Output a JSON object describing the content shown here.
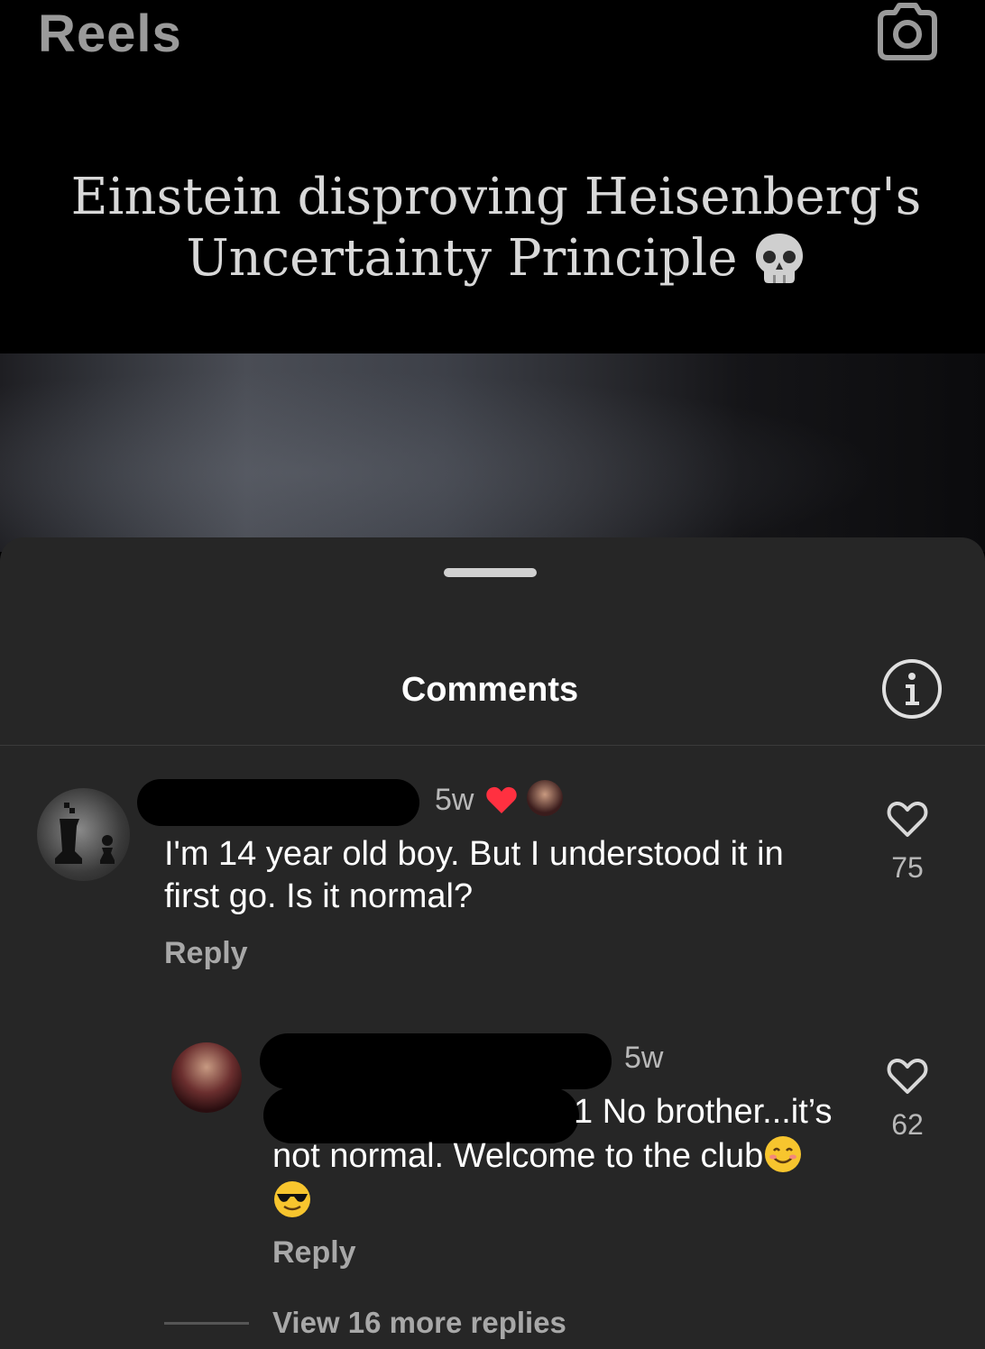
{
  "header": {
    "title": "Reels",
    "camera_icon": "camera-icon"
  },
  "video": {
    "caption_line1": "Einstein disproving Heisenberg's",
    "caption_line2": "Uncertainty Principle",
    "caption_emoji": "skull-emoji"
  },
  "comments_sheet": {
    "title": "Comments",
    "info_icon": "info-icon",
    "comments": [
      {
        "time": "5w",
        "text": "I'm 14 year old boy. But I understood it in first go. Is it normal?",
        "reply_label": "Reply",
        "likes": "75",
        "liked_by_creator": true
      }
    ],
    "replies": [
      {
        "time": "5w",
        "text_fragment_1": "1 No brother...it’s",
        "text_line_2": "not normal. Welcome to the club",
        "reply_label": "Reply",
        "likes": "62"
      }
    ],
    "view_more_label": "View 16 more replies"
  },
  "colors": {
    "heart_red": "#ff3040",
    "sheet_bg": "#262626",
    "muted_text": "#a8a8a8"
  }
}
